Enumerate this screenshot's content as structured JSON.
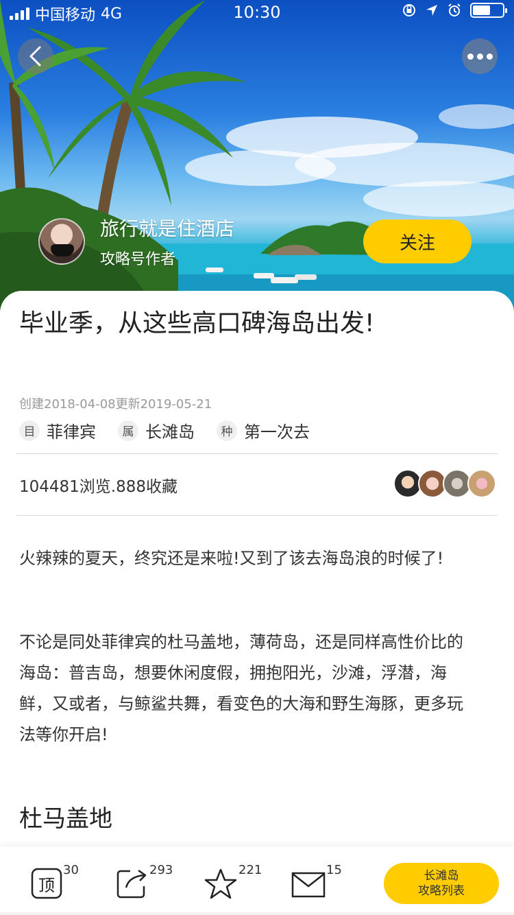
{
  "status_bar": {
    "carrier": "中国移动",
    "network": "4G",
    "time": "10:30"
  },
  "author": {
    "name": "旅行就是住酒店",
    "role": "攻略号作者",
    "follow_label": "关注"
  },
  "article": {
    "title": "毕业季，从这些高口碑海岛出发!",
    "dates": "创建2018-04-08更新2019-05-21",
    "tags": [
      {
        "mark": "目",
        "value": "菲律宾"
      },
      {
        "mark": "属",
        "value": "长滩岛"
      },
      {
        "mark": "种",
        "value": "第一次去"
      }
    ],
    "stats": "104481浏览.888收藏",
    "paragraphs": [
      "火辣辣的夏天，终究还是来啦!又到了该去海岛浪的时候了!",
      "不论是同处菲律宾的杜马盖地，薄荷岛，还是同样高性价比的海岛：普吉岛，想要休闲度假，拥抱阳光，沙滩，浮潜，海鲜，又或者，与鲸鲨共舞，看变色的大海和野生海豚，更多玩法等你开启!"
    ],
    "section_heading": "杜马盖地"
  },
  "bottom_bar": {
    "top": {
      "icon": "top-icon",
      "glyph": "顶",
      "count": "30"
    },
    "share": {
      "icon": "share-icon",
      "count": "293"
    },
    "favorite": {
      "icon": "star-icon",
      "count": "221"
    },
    "message": {
      "icon": "mail-icon",
      "count": "15"
    },
    "list_button": {
      "line1": "长滩岛",
      "line2": "攻略列表"
    }
  },
  "colors": {
    "accent": "#ffcc00",
    "text": "#222222",
    "muted": "#999999"
  }
}
